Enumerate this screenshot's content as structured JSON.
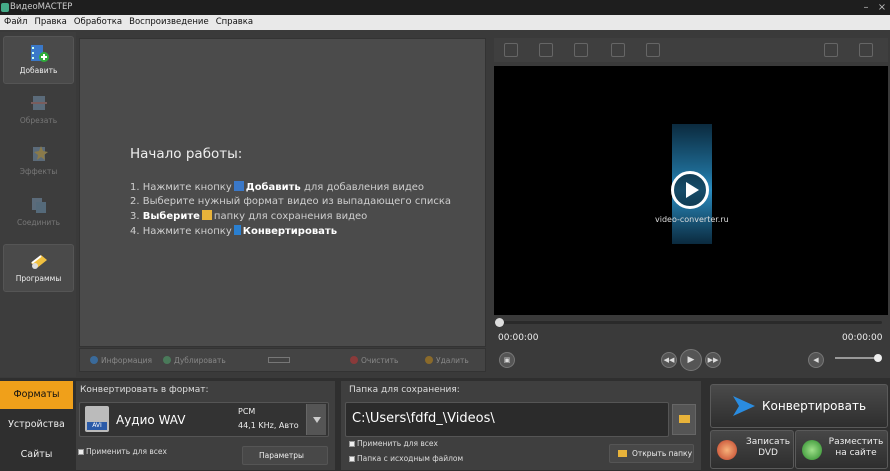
{
  "window": {
    "title": "ВидеоМАСТЕР"
  },
  "menu": [
    "Файл",
    "Правка",
    "Обработка",
    "Воспроизведение",
    "Справка"
  ],
  "sidebar": {
    "items": [
      {
        "label": "Добавить",
        "icon": "film-add-icon",
        "enabled": true
      },
      {
        "label": "Обрезать",
        "icon": "cut-icon",
        "enabled": false
      },
      {
        "label": "Эффекты",
        "icon": "effects-icon",
        "enabled": false
      },
      {
        "label": "Соединить",
        "icon": "join-icon",
        "enabled": false
      },
      {
        "label": "Программы",
        "icon": "programs-icon",
        "enabled": true
      }
    ]
  },
  "start": {
    "title": "Начало работы:",
    "step1_pre": "1. Нажмите кнопку",
    "step1_bold": "Добавить",
    "step1_post": "для добавления видео",
    "step2": "2. Выберите нужный формат видео из выпадающего списка",
    "step3_pre": "3.",
    "step3_bold": "Выберите",
    "step3_post": "папку для сохранения видео",
    "step4_pre": "4. Нажмите кнопку",
    "step4_bold": "Конвертировать"
  },
  "worktoolbar": {
    "info": "Информация",
    "duplicate": "Дублировать",
    "clear": "Очистить",
    "delete": "Удалить"
  },
  "player": {
    "watermark": "video-converter.ru",
    "time_current": "00:00:00",
    "time_total": "00:00:00",
    "position": 0,
    "volume": 0.9
  },
  "tabs": [
    "Форматы",
    "Устройства",
    "Сайты"
  ],
  "format": {
    "label": "Конвертировать в формат:",
    "name": "Аудио WAV",
    "codec": "PCM",
    "details": "44,1 KHz, Авто",
    "apply_all": "Применить для всех",
    "params": "Параметры",
    "badge": "AVI"
  },
  "save": {
    "label": "Папка для сохранения:",
    "path": "C:\\Users\\fdfd_\\Videos\\",
    "apply_all": "Применить для всех",
    "source_folder": "Папка с исходным файлом",
    "open": "Открыть папку"
  },
  "actions": {
    "convert": "Конвертировать",
    "dvd": "Записать DVD",
    "site": "Разместить на сайте"
  },
  "colors": {
    "accent": "#f0a01a",
    "bg": "#3a3a3a",
    "preview": "#000000"
  }
}
